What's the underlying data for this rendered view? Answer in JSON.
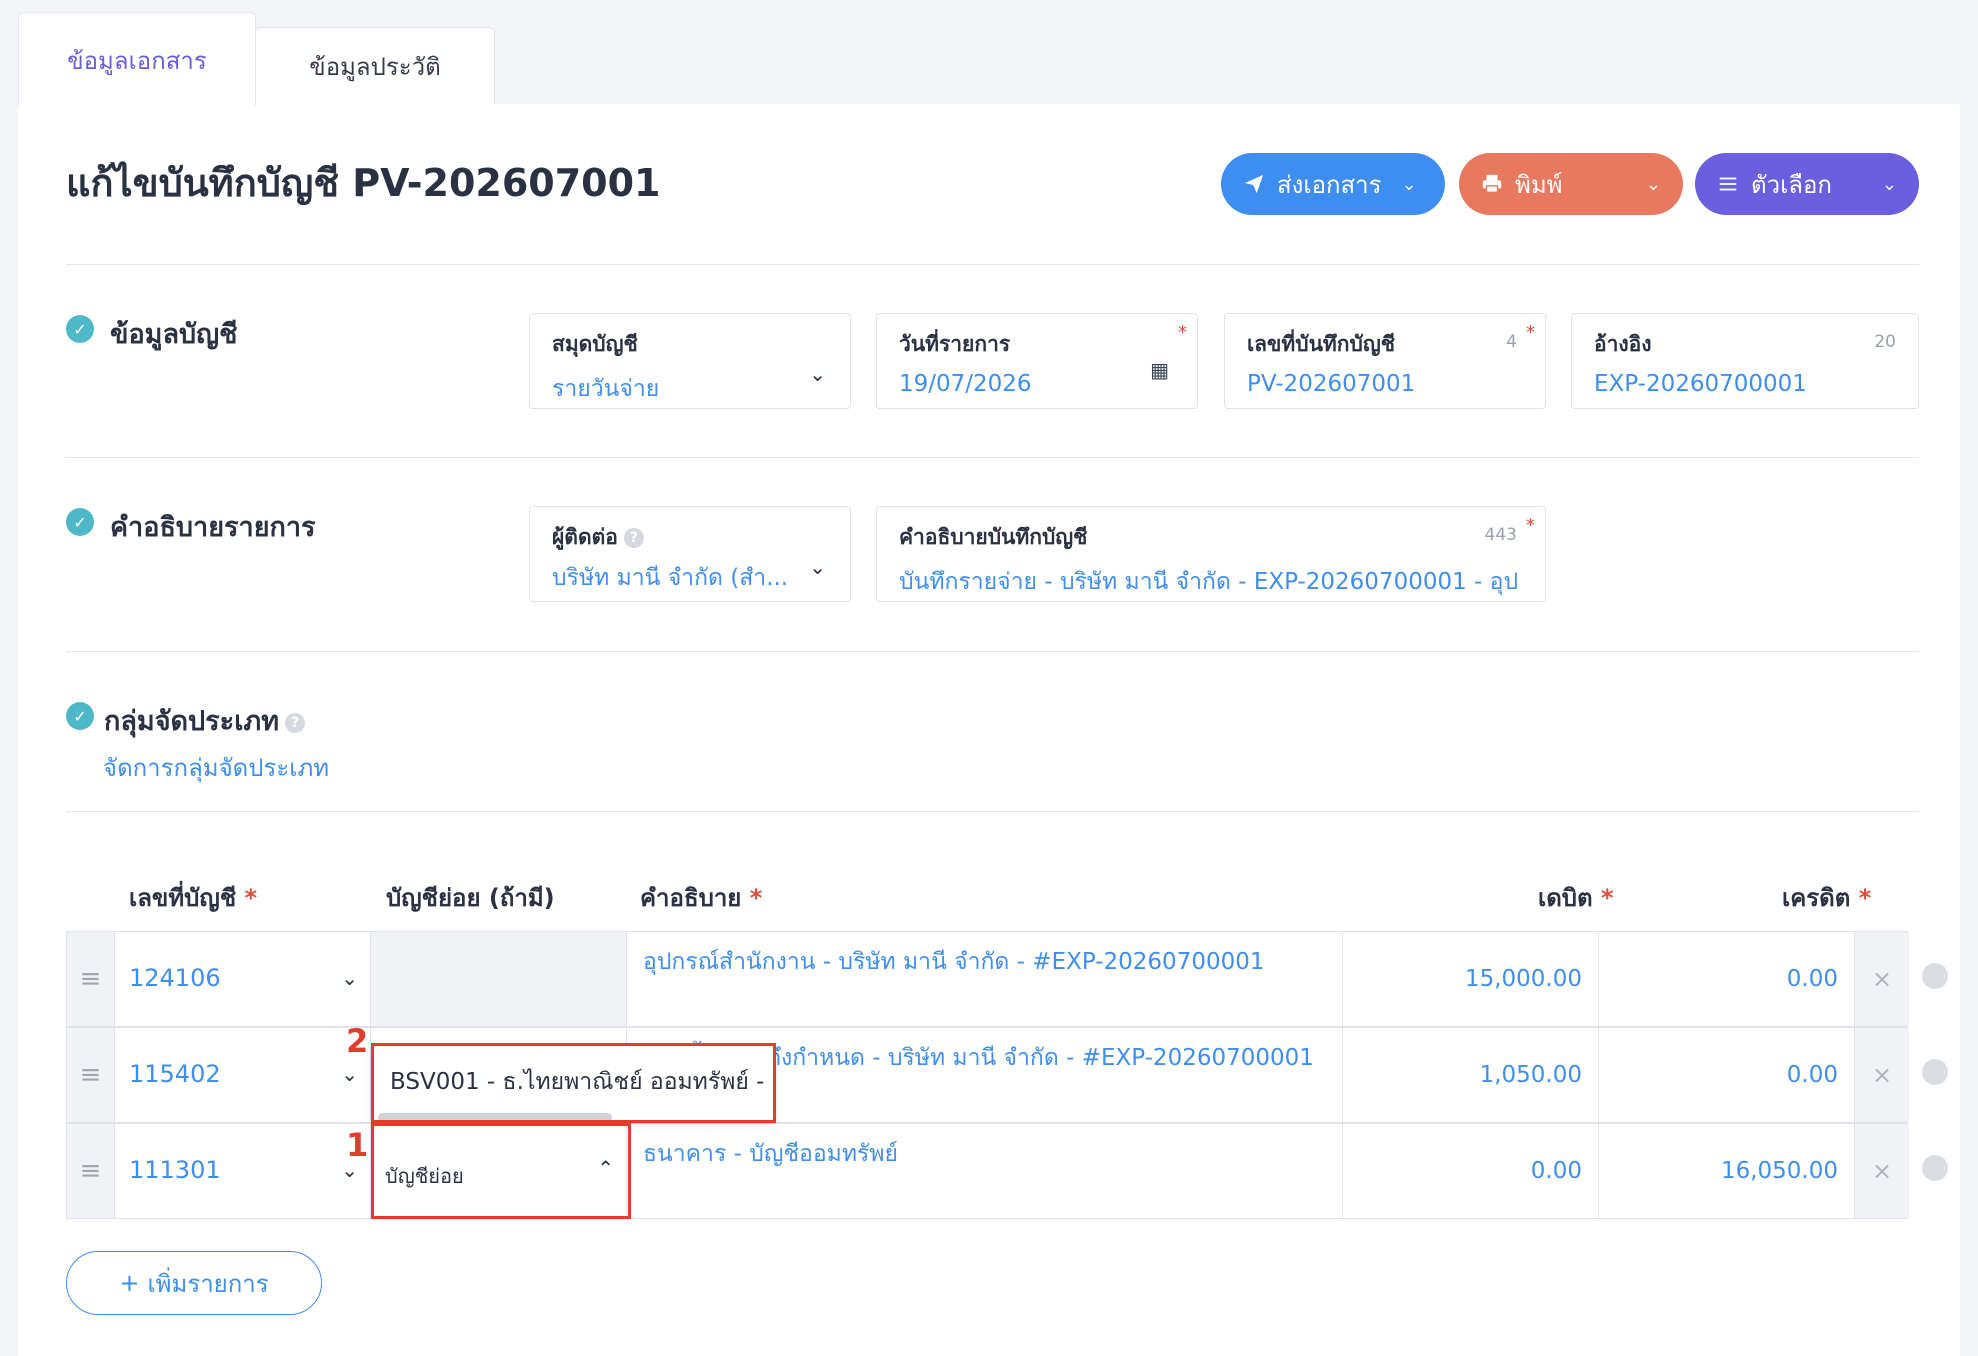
{
  "tabs": [
    {
      "label": "ข้อมูลเอกสาร"
    },
    {
      "label": "ข้อมูลประวัติ"
    }
  ],
  "page_title": "แก้ไขบันทึกบัญชี PV-202607001",
  "actions": {
    "send_label": "ส่งเอกสาร",
    "print_label": "พิมพ์",
    "options_label": "ตัวเลือก"
  },
  "section_account": {
    "title": "ข้อมูลบัญชี",
    "journal": {
      "label": "สมุดบัญชี",
      "value": "รายวันจ่าย"
    },
    "date": {
      "label": "วันที่รายการ",
      "value": "19/07/2026"
    },
    "doc_no": {
      "label": "เลขที่บันทึกบัญชี",
      "value": "PV-202607001",
      "count": "4"
    },
    "reference": {
      "label": "อ้างอิง",
      "value": "EXP-20260700001",
      "count": "20"
    }
  },
  "section_description": {
    "title": "คำอธิบายรายการ",
    "contact": {
      "label": "ผู้ติดต่อ",
      "value": "บริษัท มานี จำกัด (สำ..."
    },
    "memo": {
      "label": "คำอธิบายบันทึกบัญชี",
      "value": "บันทึกรายจ่าย - บริษัท มานี จำกัด - EXP-20260700001 - อุปก",
      "count": "443"
    }
  },
  "section_group": {
    "title": "กลุ่มจัดประเภท",
    "manage_link": "จัดการกลุ่มจัดประเภท"
  },
  "table": {
    "headers": {
      "account": "เลขที่บัญชี",
      "sub_account": "บัญชีย่อย (ถ้ามี)",
      "description": "คำอธิบาย",
      "debit": "เดบิต",
      "credit": "เครดิต"
    },
    "rows": [
      {
        "account": "124106",
        "description": "อุปกรณ์สำนักงาน  - บริษัท มานี จำกัด - #EXP-20260700001",
        "debit": "15,000.00",
        "credit": "0.00"
      },
      {
        "account": "115402",
        "description": "ภาษีซื้อยังไม่ถึงกำหนด - บริษัท มานี จำกัด - #EXP-20260700001",
        "debit": "1,050.00",
        "credit": "0.00"
      },
      {
        "account": "111301",
        "sub_account_placeholder": "บัญชีย่อย",
        "description": "ธนาคาร - บัญชีออมทรัพย์",
        "debit": "0.00",
        "credit": "16,050.00"
      }
    ],
    "dropdown_option": "BSV001 - ธ.ไทยพาณิชย์ ออมทรัพย์ -"
  },
  "add_row_label": "เพิ่มรายการ",
  "annotations": {
    "marker_1": "1",
    "marker_2": "2"
  },
  "colors": {
    "primary": "#3d8ef0",
    "send": "#3d8ef0",
    "print": "#e8785e",
    "options": "#6b5fe0",
    "highlight": "#e23d2b"
  }
}
